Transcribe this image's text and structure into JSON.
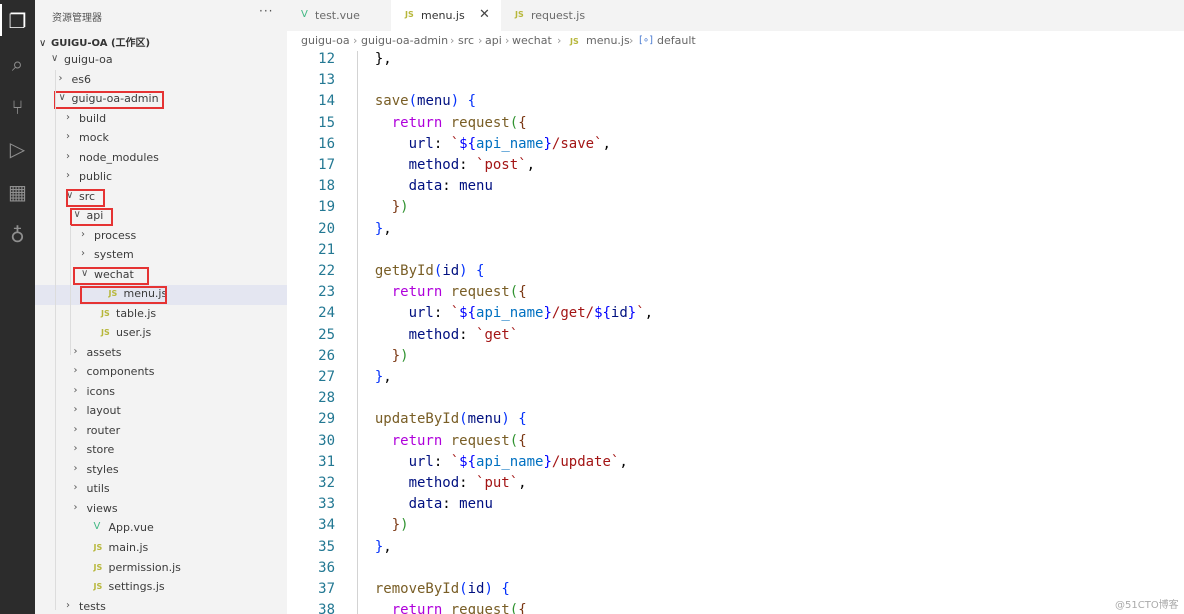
{
  "activity_bar": [
    {
      "name": "explorer-icon",
      "glyph": "❐"
    },
    {
      "name": "search-icon",
      "glyph": "⌕"
    },
    {
      "name": "source-control-icon",
      "glyph": "⑂"
    },
    {
      "name": "run-debug-icon",
      "glyph": "▷"
    },
    {
      "name": "extensions-icon",
      "glyph": "▦"
    },
    {
      "name": "remote-icon",
      "glyph": "♁"
    }
  ],
  "sidebar": {
    "header": "资源管理器",
    "more": "···",
    "workspace": "GUIGU-OA (工作区)",
    "workspace_twistie": "∨",
    "tree": [
      {
        "name": "folder-guigu-oa",
        "label": "guigu-oa",
        "kind": "folder",
        "open": true,
        "depth": 0
      },
      {
        "name": "folder-es6",
        "label": "es6",
        "kind": "folder",
        "open": false,
        "depth": 1
      },
      {
        "name": "folder-guigu-oa-admin",
        "label": "guigu-oa-admin",
        "kind": "folder",
        "open": true,
        "depth": 1
      },
      {
        "name": "folder-build",
        "label": "build",
        "kind": "folder",
        "open": false,
        "depth": 2
      },
      {
        "name": "folder-mock",
        "label": "mock",
        "kind": "folder",
        "open": false,
        "depth": 2
      },
      {
        "name": "folder-node-modules",
        "label": "node_modules",
        "kind": "folder",
        "open": false,
        "depth": 2
      },
      {
        "name": "folder-public",
        "label": "public",
        "kind": "folder",
        "open": false,
        "depth": 2
      },
      {
        "name": "folder-src",
        "label": "src",
        "kind": "folder",
        "open": true,
        "depth": 2
      },
      {
        "name": "folder-api",
        "label": "api",
        "kind": "folder",
        "open": true,
        "depth": 3
      },
      {
        "name": "folder-process",
        "label": "process",
        "kind": "folder",
        "open": false,
        "depth": 4
      },
      {
        "name": "folder-system",
        "label": "system",
        "kind": "folder",
        "open": false,
        "depth": 4
      },
      {
        "name": "folder-wechat",
        "label": "wechat",
        "kind": "folder",
        "open": true,
        "depth": 4
      },
      {
        "name": "file-menu-js",
        "label": "menu.js",
        "kind": "js",
        "depth": 5,
        "active": true
      },
      {
        "name": "file-table-js",
        "label": "table.js",
        "kind": "js",
        "depth": 4
      },
      {
        "name": "file-user-js",
        "label": "user.js",
        "kind": "js",
        "depth": 4
      },
      {
        "name": "folder-assets",
        "label": "assets",
        "kind": "folder",
        "open": false,
        "depth": 3
      },
      {
        "name": "folder-components",
        "label": "components",
        "kind": "folder",
        "open": false,
        "depth": 3
      },
      {
        "name": "folder-icons",
        "label": "icons",
        "kind": "folder",
        "open": false,
        "depth": 3
      },
      {
        "name": "folder-layout",
        "label": "layout",
        "kind": "folder",
        "open": false,
        "depth": 3
      },
      {
        "name": "folder-router",
        "label": "router",
        "kind": "folder",
        "open": false,
        "depth": 3
      },
      {
        "name": "folder-store",
        "label": "store",
        "kind": "folder",
        "open": false,
        "depth": 3
      },
      {
        "name": "folder-styles",
        "label": "styles",
        "kind": "folder",
        "open": false,
        "depth": 3
      },
      {
        "name": "folder-utils",
        "label": "utils",
        "kind": "folder",
        "open": false,
        "depth": 3
      },
      {
        "name": "folder-views",
        "label": "views",
        "kind": "folder",
        "open": false,
        "depth": 3
      },
      {
        "name": "file-app-vue",
        "label": "App.vue",
        "kind": "vue",
        "depth": 3
      },
      {
        "name": "file-main-js",
        "label": "main.js",
        "kind": "js",
        "depth": 3
      },
      {
        "name": "file-permission-js",
        "label": "permission.js",
        "kind": "js",
        "depth": 3
      },
      {
        "name": "file-settings-js",
        "label": "settings.js",
        "kind": "js",
        "depth": 3
      },
      {
        "name": "folder-tests",
        "label": "tests",
        "kind": "folder",
        "open": false,
        "depth": 2
      }
    ]
  },
  "tabs": [
    {
      "name": "tab-test-vue",
      "label": "test.vue",
      "icon": "vue",
      "active": false
    },
    {
      "name": "tab-menu-js",
      "label": "menu.js",
      "icon": "js",
      "active": true,
      "close": "✕"
    },
    {
      "name": "tab-request-js",
      "label": "request.js",
      "icon": "js",
      "active": false
    }
  ],
  "breadcrumb": {
    "parts": [
      "guigu-oa",
      "guigu-oa-admin",
      "src",
      "api",
      "wechat"
    ],
    "file": "menu.js",
    "symbol": "default",
    "separator": "›",
    "js_badge": "JS",
    "symbol_glyph": "[∘]"
  },
  "file_badges": {
    "js": "JS",
    "vue": "V"
  },
  "twisties": {
    "open": "∨",
    "closed": "›"
  },
  "editor": {
    "first_line": 12,
    "lines": [
      [
        [
          "pl",
          "  },"
        ]
      ],
      [],
      [
        [
          "pl",
          "  "
        ],
        [
          "fn",
          "save"
        ],
        [
          "br1",
          "("
        ],
        [
          "pr",
          "menu"
        ],
        [
          "br1",
          ")"
        ],
        [
          "pl",
          " "
        ],
        [
          "br1",
          "{"
        ]
      ],
      [
        [
          "pl",
          "    "
        ],
        [
          "kw",
          "return"
        ],
        [
          "pl",
          " "
        ],
        [
          "fn",
          "request"
        ],
        [
          "br2",
          "("
        ],
        [
          "br3",
          "{"
        ]
      ],
      [
        [
          "pl",
          "      "
        ],
        [
          "pr",
          "url"
        ],
        [
          "pl",
          ": "
        ],
        [
          "str",
          "`"
        ],
        [
          "tp",
          "${"
        ],
        [
          "vr",
          "api_name"
        ],
        [
          "tp",
          "}"
        ],
        [
          "str",
          "/save`"
        ],
        [
          "pl",
          ","
        ]
      ],
      [
        [
          "pl",
          "      "
        ],
        [
          "pr",
          "method"
        ],
        [
          "pl",
          ": "
        ],
        [
          "str",
          "`post`"
        ],
        [
          "pl",
          ","
        ]
      ],
      [
        [
          "pl",
          "      "
        ],
        [
          "pr",
          "data"
        ],
        [
          "pl",
          ": "
        ],
        [
          "pr",
          "menu"
        ]
      ],
      [
        [
          "pl",
          "    "
        ],
        [
          "br3",
          "}"
        ],
        [
          "br2",
          ")"
        ]
      ],
      [
        [
          "pl",
          "  "
        ],
        [
          "br1",
          "}"
        ],
        [
          "pl",
          ","
        ]
      ],
      [],
      [
        [
          "pl",
          "  "
        ],
        [
          "fn",
          "getById"
        ],
        [
          "br1",
          "("
        ],
        [
          "pr",
          "id"
        ],
        [
          "br1",
          ")"
        ],
        [
          "pl",
          " "
        ],
        [
          "br1",
          "{"
        ]
      ],
      [
        [
          "pl",
          "    "
        ],
        [
          "kw",
          "return"
        ],
        [
          "pl",
          " "
        ],
        [
          "fn",
          "request"
        ],
        [
          "br2",
          "("
        ],
        [
          "br3",
          "{"
        ]
      ],
      [
        [
          "pl",
          "      "
        ],
        [
          "pr",
          "url"
        ],
        [
          "pl",
          ": "
        ],
        [
          "str",
          "`"
        ],
        [
          "tp",
          "${"
        ],
        [
          "vr",
          "api_name"
        ],
        [
          "tp",
          "}"
        ],
        [
          "str",
          "/get/"
        ],
        [
          "tp",
          "${"
        ],
        [
          "pr",
          "id"
        ],
        [
          "tp",
          "}"
        ],
        [
          "str",
          "`"
        ],
        [
          "pl",
          ","
        ]
      ],
      [
        [
          "pl",
          "      "
        ],
        [
          "pr",
          "method"
        ],
        [
          "pl",
          ": "
        ],
        [
          "str",
          "`get`"
        ]
      ],
      [
        [
          "pl",
          "    "
        ],
        [
          "br3",
          "}"
        ],
        [
          "br2",
          ")"
        ]
      ],
      [
        [
          "pl",
          "  "
        ],
        [
          "br1",
          "}"
        ],
        [
          "pl",
          ","
        ]
      ],
      [],
      [
        [
          "pl",
          "  "
        ],
        [
          "fn",
          "updateById"
        ],
        [
          "br1",
          "("
        ],
        [
          "pr",
          "menu"
        ],
        [
          "br1",
          ")"
        ],
        [
          "pl",
          " "
        ],
        [
          "br1",
          "{"
        ]
      ],
      [
        [
          "pl",
          "    "
        ],
        [
          "kw",
          "return"
        ],
        [
          "pl",
          " "
        ],
        [
          "fn",
          "request"
        ],
        [
          "br2",
          "("
        ],
        [
          "br3",
          "{"
        ]
      ],
      [
        [
          "pl",
          "      "
        ],
        [
          "pr",
          "url"
        ],
        [
          "pl",
          ": "
        ],
        [
          "str",
          "`"
        ],
        [
          "tp",
          "${"
        ],
        [
          "vr",
          "api_name"
        ],
        [
          "tp",
          "}"
        ],
        [
          "str",
          "/update`"
        ],
        [
          "pl",
          ","
        ]
      ],
      [
        [
          "pl",
          "      "
        ],
        [
          "pr",
          "method"
        ],
        [
          "pl",
          ": "
        ],
        [
          "str",
          "`put`"
        ],
        [
          "pl",
          ","
        ]
      ],
      [
        [
          "pl",
          "      "
        ],
        [
          "pr",
          "data"
        ],
        [
          "pl",
          ": "
        ],
        [
          "pr",
          "menu"
        ]
      ],
      [
        [
          "pl",
          "    "
        ],
        [
          "br3",
          "}"
        ],
        [
          "br2",
          ")"
        ]
      ],
      [
        [
          "pl",
          "  "
        ],
        [
          "br1",
          "}"
        ],
        [
          "pl",
          ","
        ]
      ],
      [],
      [
        [
          "pl",
          "  "
        ],
        [
          "fn",
          "removeById"
        ],
        [
          "br1",
          "("
        ],
        [
          "pr",
          "id"
        ],
        [
          "br1",
          ")"
        ],
        [
          "pl",
          " "
        ],
        [
          "br1",
          "{"
        ]
      ],
      [
        [
          "pl",
          "    "
        ],
        [
          "kw",
          "return"
        ],
        [
          "pl",
          " "
        ],
        [
          "fn",
          "request"
        ],
        [
          "br2",
          "("
        ],
        [
          "br3",
          "{"
        ]
      ]
    ]
  },
  "watermark": "@51CTO博客"
}
